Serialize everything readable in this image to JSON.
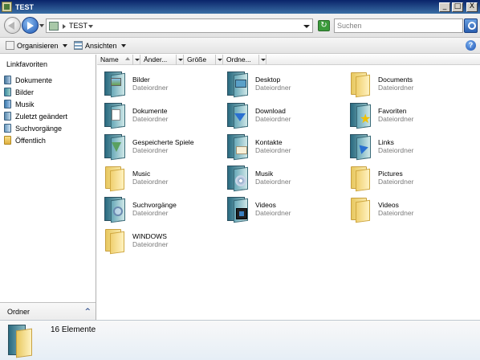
{
  "window": {
    "title": "TEST",
    "minimize": "_",
    "maximize": "□",
    "close": "X"
  },
  "address": {
    "path": "TEST",
    "refresh": "↻"
  },
  "search": {
    "placeholder": "Suchen"
  },
  "toolbar": {
    "organize": "Organisieren",
    "views": "Ansichten",
    "help": "?"
  },
  "sidebar": {
    "title": "Linkfavoriten",
    "items": [
      {
        "label": "Dokumente",
        "icon": "documents-icon"
      },
      {
        "label": "Bilder",
        "icon": "pictures-icon"
      },
      {
        "label": "Musik",
        "icon": "music-icon"
      },
      {
        "label": "Zuletzt geändert",
        "icon": "recent-icon"
      },
      {
        "label": "Suchvorgänge",
        "icon": "searches-icon"
      },
      {
        "label": "Öffentlich",
        "icon": "public-folder-icon"
      }
    ],
    "folders_label": "Ordner",
    "folders_chevron": "^"
  },
  "columns": [
    "Name",
    "Änder...",
    "Größe",
    "Ordne..."
  ],
  "files": [
    {
      "name": "Bilder",
      "type": "Dateiordner",
      "icon": "pictures-folder-icon"
    },
    {
      "name": "Desktop",
      "type": "Dateiordner",
      "icon": "desktop-folder-icon"
    },
    {
      "name": "Documents",
      "type": "Dateiordner",
      "icon": "folder-icon"
    },
    {
      "name": "Dokumente",
      "type": "Dateiordner",
      "icon": "documents-folder-icon"
    },
    {
      "name": "Download",
      "type": "Dateiordner",
      "icon": "downloads-folder-icon"
    },
    {
      "name": "Favoriten",
      "type": "Dateiordner",
      "icon": "favorites-folder-icon"
    },
    {
      "name": "Gespeicherte Spiele",
      "type": "Dateiordner",
      "icon": "saved-games-folder-icon"
    },
    {
      "name": "Kontakte",
      "type": "Dateiordner",
      "icon": "contacts-folder-icon"
    },
    {
      "name": "Links",
      "type": "Dateiordner",
      "icon": "links-folder-icon"
    },
    {
      "name": "Music",
      "type": "Dateiordner",
      "icon": "folder-icon"
    },
    {
      "name": "Musik",
      "type": "Dateiordner",
      "icon": "music-folder-icon"
    },
    {
      "name": "Pictures",
      "type": "Dateiordner",
      "icon": "folder-icon"
    },
    {
      "name": "Suchvorgänge",
      "type": "Dateiordner",
      "icon": "searches-folder-icon"
    },
    {
      "name": "Videos",
      "type": "Dateiordner",
      "icon": "videos-folder-icon"
    },
    {
      "name": "Videos",
      "type": "Dateiordner",
      "icon": "folder-icon"
    },
    {
      "name": "WINDOWS",
      "type": "Dateiordner",
      "icon": "folder-icon"
    }
  ],
  "status": {
    "count_text": "16 Elemente"
  }
}
